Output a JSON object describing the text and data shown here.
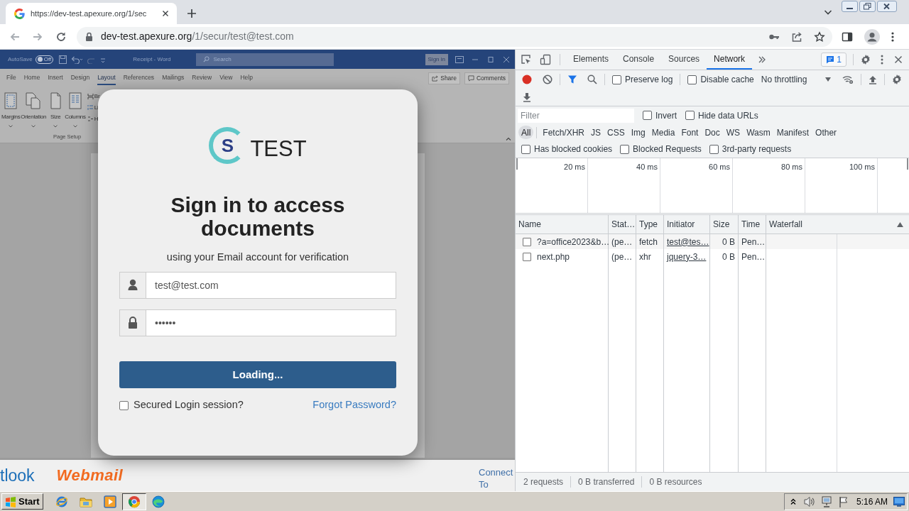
{
  "browser": {
    "tab": {
      "title": "https://dev-test.apexure.org/1/sec",
      "selected": true
    },
    "address": {
      "host": "dev-test.apexure.org",
      "path": "/1/secur/test@test.com"
    }
  },
  "word": {
    "autosave": "AutoSave",
    "autosave_toggle": "Off",
    "title": "Receipt - Word",
    "search_placeholder": "Search",
    "sign_in": "Sign in",
    "ribbon_tabs": [
      {
        "label": "File",
        "selected": false
      },
      {
        "label": "Home",
        "selected": false
      },
      {
        "label": "Insert",
        "selected": false
      },
      {
        "label": "Design",
        "selected": false
      },
      {
        "label": "Layout",
        "selected": true
      },
      {
        "label": "References",
        "selected": false
      },
      {
        "label": "Mailings",
        "selected": false
      },
      {
        "label": "Review",
        "selected": false
      },
      {
        "label": "View",
        "selected": false
      },
      {
        "label": "Help",
        "selected": false
      }
    ],
    "share": "Share",
    "comments": "Comments",
    "ribbon_buttons": [
      {
        "kind": "margins",
        "label": "Margins"
      },
      {
        "kind": "orientation",
        "label": "Orientation"
      },
      {
        "kind": "size",
        "label": "Size"
      },
      {
        "kind": "columns",
        "label": "Columns"
      }
    ],
    "ribbon_small_items": [
      {
        "kind": "breaks",
        "label": "Br"
      },
      {
        "kind": "line_numbers",
        "label": "Li"
      },
      {
        "kind": "hyphenation",
        "label": "H"
      }
    ],
    "group_label": "Page Setup"
  },
  "login": {
    "logo_letter": "S",
    "brand": "TEST",
    "heading": "Sign in to access documents",
    "subtitle": "using your Email account for verification",
    "fields": [
      {
        "kind": "user",
        "value": "test@test.com"
      },
      {
        "kind": "password",
        "value": "••••••"
      }
    ],
    "submit": "Loading...",
    "remember": {
      "label": "Secured Login session?",
      "checked": false
    },
    "forgot_link": "Forgot Password?"
  },
  "footer": {
    "outlook": "tlook",
    "webmail": "Webmail",
    "connect": "Connect To"
  },
  "devtools": {
    "tabs": [
      {
        "label": "Elements",
        "selected": false
      },
      {
        "label": "Console",
        "selected": false
      },
      {
        "label": "Sources",
        "selected": false
      },
      {
        "label": "Network",
        "selected": true
      }
    ],
    "issues_count": "1",
    "recording": true,
    "toolbar_checkboxes": [
      {
        "label": "Preserve log",
        "checked": false
      },
      {
        "label": "Disable cache",
        "checked": false
      }
    ],
    "throttling": "No throttling",
    "filter": {
      "placeholder": "Filter"
    },
    "filter_checkboxes": [
      {
        "label": "Invert",
        "checked": false
      },
      {
        "label": "Hide data URLs",
        "checked": false
      }
    ],
    "type_filters": [
      {
        "label": "All",
        "selected": true
      },
      {
        "label": "Fetch/XHR",
        "selected": false
      },
      {
        "label": "JS",
        "selected": false
      },
      {
        "label": "CSS",
        "selected": false
      },
      {
        "label": "Img",
        "selected": false
      },
      {
        "label": "Media",
        "selected": false
      },
      {
        "label": "Font",
        "selected": false
      },
      {
        "label": "Doc",
        "selected": false
      },
      {
        "label": "WS",
        "selected": false
      },
      {
        "label": "Wasm",
        "selected": false
      },
      {
        "label": "Manifest",
        "selected": false
      },
      {
        "label": "Other",
        "selected": false
      }
    ],
    "request_checkboxes": [
      {
        "label": "Has blocked cookies",
        "checked": false
      },
      {
        "label": "Blocked Requests",
        "checked": false
      },
      {
        "label": "3rd-party requests",
        "checked": false
      }
    ],
    "overview_ticks": [
      "20 ms",
      "40 ms",
      "60 ms",
      "80 ms",
      "100 ms"
    ],
    "table": {
      "columns": [
        "Name",
        "Stat…",
        "Type",
        "Initiator",
        "Size",
        "Time",
        "Waterfall"
      ],
      "rows": [
        {
          "checked": false,
          "cells": [
            "?a=office2023&b…",
            "(pe…",
            "fetch",
            "test@tes…",
            "0 B",
            "Pen…"
          ]
        },
        {
          "checked": false,
          "cells": [
            "next.php",
            "(pe…",
            "xhr",
            "jquery-3…",
            "0 B",
            "Pen…"
          ]
        }
      ]
    },
    "status_bar": [
      "2 requests",
      "0 B transferred",
      "0 B resources"
    ]
  },
  "taskbar": {
    "start": "Start",
    "apps": [
      {
        "kind": "internet_explorer",
        "selected": false
      },
      {
        "kind": "folder",
        "selected": false
      },
      {
        "kind": "media_player",
        "selected": false
      },
      {
        "kind": "chrome",
        "selected": true
      },
      {
        "kind": "edge",
        "selected": false
      }
    ],
    "clock": "5:16 AM"
  }
}
